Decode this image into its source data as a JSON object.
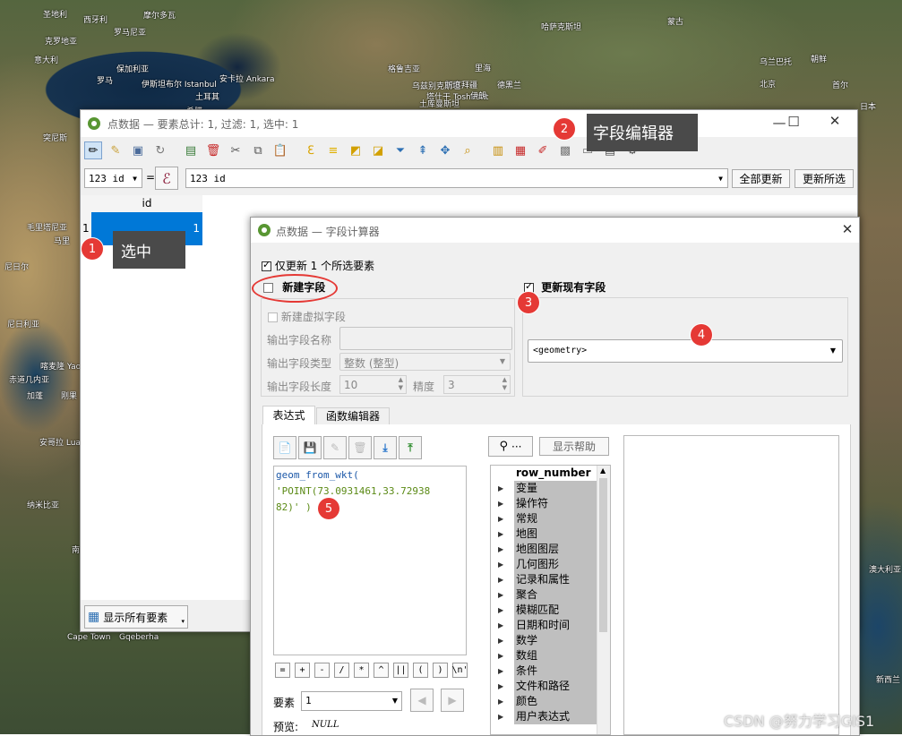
{
  "map": {
    "labels": [
      "圣地利",
      "西牙利",
      "摩尔多瓦",
      "克罗地亚",
      "罗马尼亚",
      "意大利",
      "保加利亚",
      "罗马",
      "伊斯坦布尔 Istanbul",
      "安卡拉 Ankara",
      "土耳其",
      "突尼斯",
      "希腊",
      "格鲁吉亚",
      "阿塞拜疆",
      "里海",
      "乌兹别克斯坦",
      "塔什干 Toshkent",
      "土库曼斯坦",
      "德黑兰",
      "伊朗",
      "哈萨克斯坦",
      "蒙古",
      "乌兰巴托",
      "北京",
      "朝鲜",
      "首尔",
      "日本",
      "尼日尔",
      "尼日利亚",
      "喀麦隆 Yaoundé",
      "赤道几内亚",
      "加蓬",
      "刚果",
      "安哥拉 Luanda",
      "纳米比亚",
      "南非",
      "Cape Town",
      "Gqeberha",
      "澳大利亚",
      "新西兰",
      "毛里塔尼亚",
      "马里",
      "苏丹",
      "埃塞俄比亚"
    ]
  },
  "attr_window": {
    "title": "点数据 — 要素总计: 1, 过滤: 1, 选中: 1",
    "field_combo": "123 id",
    "equals": "=",
    "epsilon": "ℰ",
    "expression_value": "123 id",
    "update_all": "全部更新",
    "update_selected": "更新所选",
    "column_header": "id",
    "rows": [
      {
        "row_num": "1",
        "id": "1"
      }
    ],
    "show_all_features": "显示所有要素"
  },
  "calc_dialog": {
    "title": "点数据 — 字段计算器",
    "only_update_selected": "仅更新 1 个所选要素",
    "create_new_field": "新建字段",
    "create_virtual_field": "新建虚拟字段",
    "output_field_name_label": "输出字段名称",
    "output_field_type_label": "输出字段类型",
    "output_field_type_value": "整数 (整型)",
    "output_field_length_label": "输出字段长度",
    "output_field_length_value": "10",
    "precision_label": "精度",
    "precision_value": "3",
    "update_existing_field": "更新现有字段",
    "existing_field_value": "<geometry>",
    "tab_expression": "表达式",
    "tab_function_editor": "函数编辑器",
    "expression_lines": [
      "geom_from_wkt(",
      "'POINT(73.0931461,33.72938",
      "82)' )"
    ],
    "search_ellipsis": "···",
    "show_help": "显示帮助",
    "function_tree_first": "row_number",
    "function_tree": [
      "变量",
      "操作符",
      "常规",
      "地图",
      "地图图层",
      "几何图形",
      "记录和属性",
      "聚合",
      "模糊匹配",
      "日期和时间",
      "数学",
      "数组",
      "条件",
      "文件和路径",
      "颜色",
      "用户表达式"
    ],
    "operators": [
      "=",
      "+",
      "-",
      "/",
      "*",
      "^",
      "||",
      "(",
      ")",
      "\\n'"
    ],
    "feature_label": "要素",
    "feature_value": "1",
    "preview_label": "预览:",
    "preview_value": "NULL"
  },
  "annotations": {
    "badge1": "1",
    "badge2": "2",
    "badge3": "3",
    "badge4": "4",
    "badge5": "5",
    "tip_selected": "选中",
    "tip_field_editor": "字段编辑器"
  },
  "watermark": "CSDN @努力学习GIS1",
  "colors": {
    "selection_blue": "#0078d7",
    "badge_red": "#e53935",
    "tooltip_gray": "#4a4a4a",
    "code_green": "#5b8a16",
    "code_blue": "#1c58a8"
  }
}
